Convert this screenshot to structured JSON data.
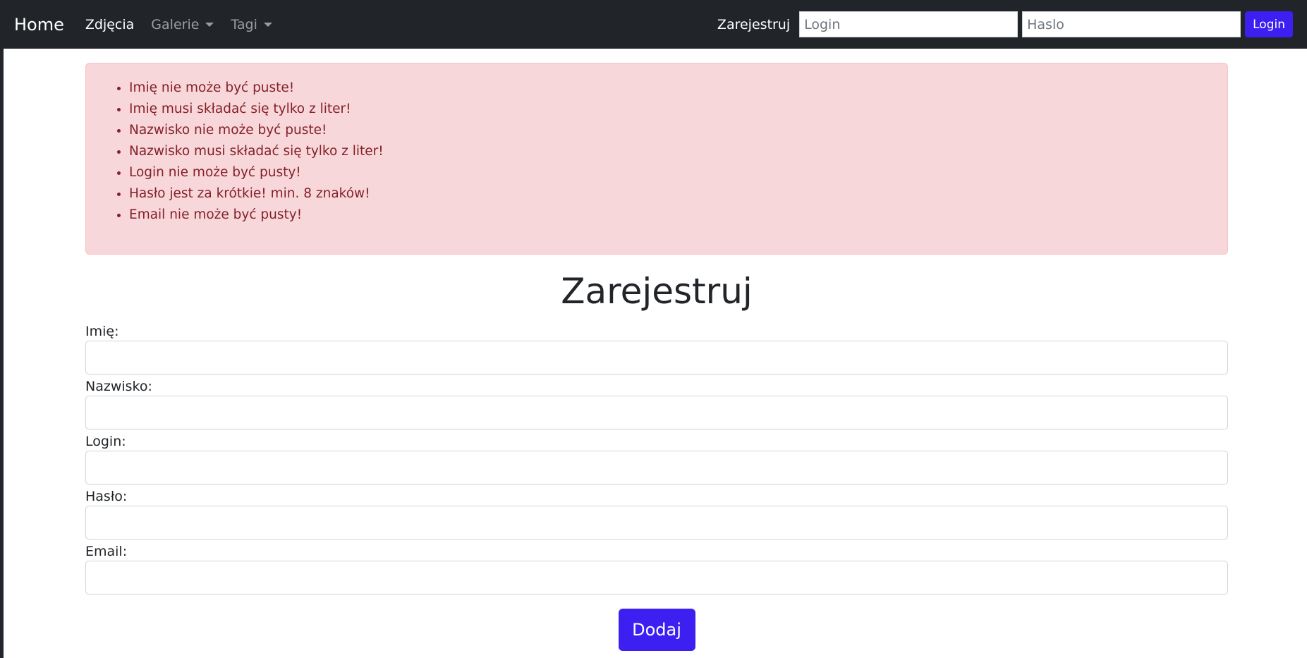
{
  "navbar": {
    "brand": "Home",
    "links": [
      {
        "label": "Zdjęcia"
      },
      {
        "label": "Galerie"
      },
      {
        "label": "Tagi"
      }
    ],
    "register_label": "Zarejestruj",
    "login_placeholder": "Login",
    "password_placeholder": "Haslo",
    "login_button": "Login",
    "icons": [
      "caret-down-icon"
    ]
  },
  "alert": {
    "errors": [
      "Imię nie może być puste!",
      "Imię musi składać się tylko z liter!",
      "Nazwisko nie może być puste!",
      "Nazwisko musi składać się tylko z liter!",
      "Login nie może być pusty!",
      "Hasło jest za krótkie! min. 8 znaków!",
      "Email nie może być pusty!"
    ]
  },
  "form": {
    "title": "Zarejestruj",
    "fields": [
      {
        "label": "Imię:",
        "value": ""
      },
      {
        "label": "Nazwisko:",
        "value": ""
      },
      {
        "label": "Login:",
        "value": ""
      },
      {
        "label": "Hasło:",
        "value": ""
      },
      {
        "label": "Email:",
        "value": ""
      }
    ],
    "submit_label": "Dodaj"
  },
  "colors": {
    "navbar_bg": "#212529",
    "accent": "#3d1ff2",
    "alert_bg": "#f8d7da",
    "alert_text": "#842029"
  }
}
